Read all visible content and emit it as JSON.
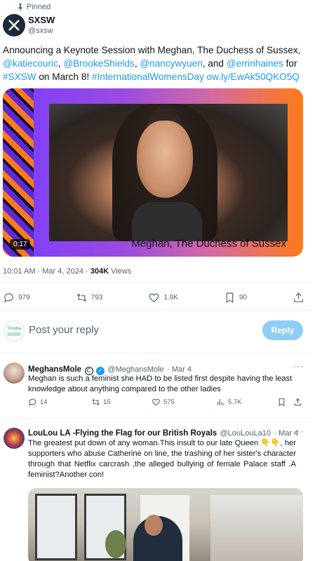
{
  "pinned_label": "Pinned",
  "tweet": {
    "author_name": "SXSW",
    "author_handle": "@sxsw",
    "text_line1": "Announcing a Keynote Session with Meghan, The Duchess of Sussex,",
    "mentions": [
      "@katiecouric",
      "@BrookeShields",
      "@nancywyuen",
      "@errinhaines"
    ],
    "and_word": ", and ",
    "for_word": " for",
    "hashtag_sxsw": "#SXSW",
    "on_march": " on March 8! ",
    "hashtag_iwd": "#InternationalWomensDay",
    "short_link": "ow.ly/EwAk50QKO5Q",
    "media_caption": "Meghan, The Duchess of Sussex",
    "media_duration": "0:17",
    "time": "10:01 AM · Mar 4, 2024 · ",
    "views_count": "304K",
    "views_label": " Views",
    "stats": {
      "replies": "979",
      "reposts": "793",
      "likes": "1.9K",
      "bookmarks": "90"
    }
  },
  "reply_composer": {
    "avatar_text_top": "Tonoba",
    "placeholder": "Post your reply",
    "button_label": "Reply"
  },
  "comments": [
    {
      "name": "MeghansMole",
      "handle": "@MeghansMole",
      "date": "· Mar 4",
      "text": "Meghan is such a feminist she HAD to be listed first despite having the least knowledge about anything compared to the other ladies",
      "replies": "14",
      "reposts": "15",
      "likes": "575",
      "views": "5.7K"
    },
    {
      "name": "LouLou LA -Flying the Flag for our British Royals",
      "handle": "@LouLouLa10",
      "date": "· Mar 4",
      "text": "The greatest put down of any woman.This insult to our late Queen 👇👇, her supporters who abuse Catherine on line, the trashing of her sister's character through that Netflix carcrash ,the alleged bullying of female Palace staff .A feminist?Another con!"
    }
  ],
  "colors": {
    "accent": "#1d9bf0",
    "muted": "#536471",
    "reply_button": "#8ecdf8"
  }
}
